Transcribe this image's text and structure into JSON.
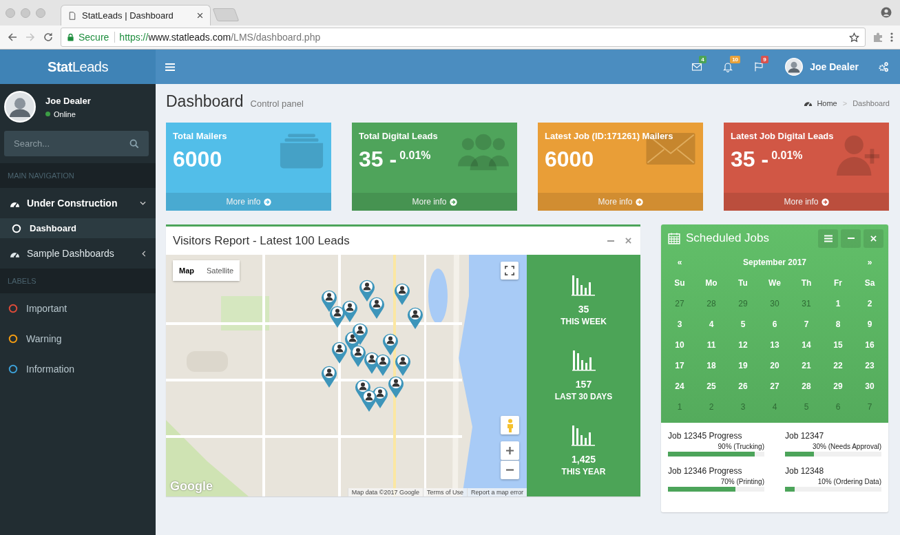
{
  "browser": {
    "tab_title": "StatLeads | Dashboard",
    "secure_label": "Secure",
    "url_scheme": "https://",
    "url_host": "www.statleads.com",
    "url_path": "/LMS/dashboard.php"
  },
  "header": {
    "logo_bold": "Stat",
    "logo_light": "Leads",
    "notifications": [
      {
        "kind": "mail",
        "count": "4",
        "color": "#4ca456"
      },
      {
        "kind": "bell",
        "count": "10",
        "color": "#e9a23a"
      },
      {
        "kind": "flag",
        "count": "9",
        "color": "#d9534f"
      }
    ],
    "user_name": "Joe Dealer"
  },
  "sidebar": {
    "user": {
      "name": "Joe Dealer",
      "status": "Online"
    },
    "search": {
      "placeholder": "Search..."
    },
    "navigation": {
      "header": "MAIN NAVIGATION",
      "items": [
        {
          "label": "Under Construction",
          "expanded": true,
          "children": [
            {
              "label": "Dashboard",
              "selected": true
            }
          ]
        },
        {
          "label": "Sample Dashboards",
          "expanded": false
        }
      ]
    },
    "labels": {
      "header": "LABELS",
      "items": [
        {
          "label": "Important",
          "color": "#dd4b39"
        },
        {
          "label": "Warning",
          "color": "#f39c12"
        },
        {
          "label": "Information",
          "color": "#3c9fd6"
        }
      ]
    }
  },
  "page": {
    "title": "Dashboard",
    "subtitle": "Control panel",
    "breadcrumb": {
      "items": [
        "Home",
        "Dashboard"
      ],
      "separator": ">"
    }
  },
  "info_boxes": [
    {
      "title": "Total Mailers",
      "value": "6000",
      "kind": "folder",
      "color": "#52bee9",
      "footer": "More info"
    },
    {
      "title": "Total Digital Leads",
      "value": "35 -",
      "percent": "0.01%",
      "kind": "users",
      "color": "#4fa45b",
      "footer": "More info"
    },
    {
      "title": "Latest Job (ID:171261) Mailers",
      "value": "6000",
      "kind": "envelope",
      "color": "#e99e37",
      "footer": "More info"
    },
    {
      "title": "Latest Job Digital Leads",
      "value": "35 -",
      "percent": "0.01%",
      "kind": "user-plus",
      "color": "#d15745",
      "footer": "More info"
    }
  ],
  "visitors_report": {
    "title": "Visitors Report - Latest 100 Leads",
    "map": {
      "kind": "picture",
      "type_buttons": [
        {
          "label": "Map",
          "selected": true
        },
        {
          "label": "Satellite",
          "selected": false
        }
      ],
      "logo": "Google",
      "attribution": [
        "Map data ©2017 Google",
        "Terms of Use",
        "Report a map error"
      ]
    },
    "stats": [
      {
        "value": "35",
        "label": "THIS WEEK"
      },
      {
        "value": "157",
        "label": "LAST 30 DAYS"
      },
      {
        "value": "1,425",
        "label": "THIS YEAR"
      }
    ]
  },
  "scheduled_jobs": {
    "title": "Scheduled Jobs",
    "calendar": {
      "prev": "«",
      "month": "September 2017",
      "next": "»",
      "weekdays": [
        "Su",
        "Mo",
        "Tu",
        "We",
        "Th",
        "Fr",
        "Sa"
      ],
      "weeks": [
        [
          {
            "day": "27",
            "other_month": true
          },
          {
            "day": "28",
            "other_month": true
          },
          {
            "day": "29",
            "other_month": true
          },
          {
            "day": "30",
            "other_month": true
          },
          {
            "day": "31",
            "other_month": true
          },
          {
            "day": "1",
            "other_month": false
          },
          {
            "day": "2",
            "other_month": false
          }
        ],
        [
          {
            "day": "3",
            "other_month": false
          },
          {
            "day": "4",
            "other_month": false
          },
          {
            "day": "5",
            "other_month": false
          },
          {
            "day": "6",
            "other_month": false
          },
          {
            "day": "7",
            "other_month": false
          },
          {
            "day": "8",
            "other_month": false
          },
          {
            "day": "9",
            "other_month": false
          }
        ],
        [
          {
            "day": "10",
            "other_month": false
          },
          {
            "day": "11",
            "other_month": false
          },
          {
            "day": "12",
            "other_month": false
          },
          {
            "day": "13",
            "other_month": false
          },
          {
            "day": "14",
            "other_month": false
          },
          {
            "day": "15",
            "other_month": false
          },
          {
            "day": "16",
            "other_month": false
          }
        ],
        [
          {
            "day": "17",
            "other_month": false
          },
          {
            "day": "18",
            "other_month": false
          },
          {
            "day": "19",
            "other_month": false
          },
          {
            "day": "20",
            "other_month": false
          },
          {
            "day": "21",
            "other_month": false
          },
          {
            "day": "22",
            "other_month": false
          },
          {
            "day": "23",
            "other_month": false
          }
        ],
        [
          {
            "day": "24",
            "other_month": false
          },
          {
            "day": "25",
            "other_month": false
          },
          {
            "day": "26",
            "other_month": false
          },
          {
            "day": "27",
            "other_month": false
          },
          {
            "day": "28",
            "other_month": false
          },
          {
            "day": "29",
            "other_month": false
          },
          {
            "day": "30",
            "other_month": false
          }
        ],
        [
          {
            "day": "1",
            "other_month": true
          },
          {
            "day": "2",
            "other_month": true
          },
          {
            "day": "3",
            "other_month": true
          },
          {
            "day": "4",
            "other_month": true
          },
          {
            "day": "5",
            "other_month": true
          },
          {
            "day": "6",
            "other_month": true
          },
          {
            "day": "7",
            "other_month": true
          }
        ]
      ]
    },
    "jobs": [
      {
        "title": "Job 12345 Progress",
        "status": "90% (Trucking)",
        "level": 0.9
      },
      {
        "title": "Job 12347",
        "status": "30% (Needs Approval)",
        "level": 0.3
      },
      {
        "title": "Job 12346 Progress",
        "status": "70% (Printing)",
        "level": 0.7
      },
      {
        "title": "Job 12348",
        "status": "10% (Ordering Data)",
        "level": 0.1
      }
    ]
  }
}
